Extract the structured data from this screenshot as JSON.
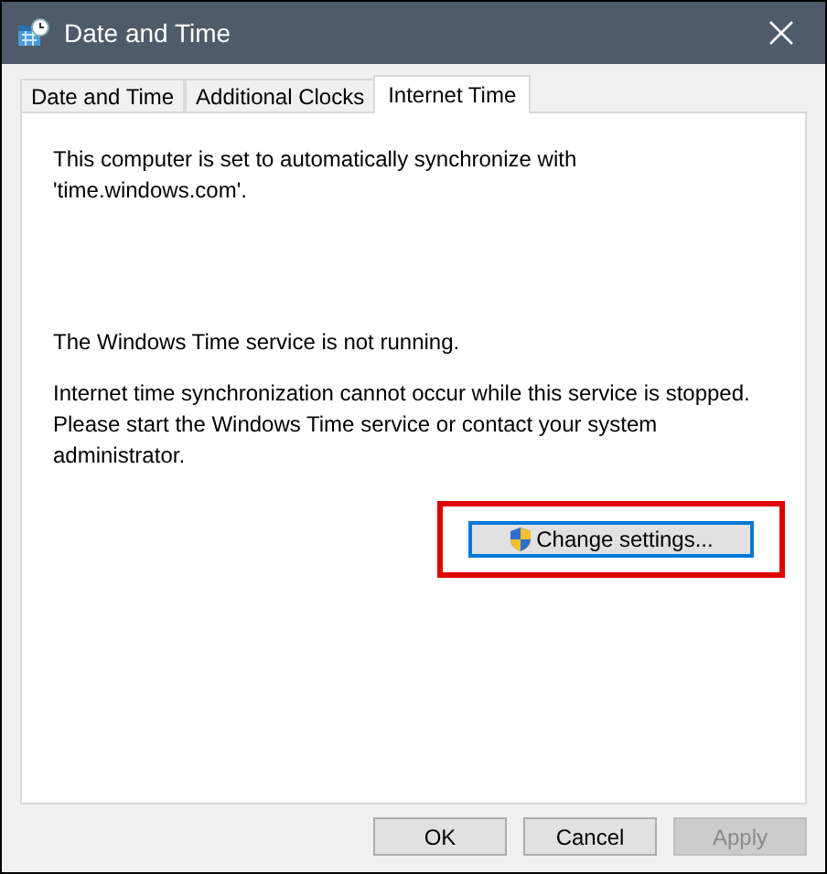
{
  "window": {
    "title": "Date and Time"
  },
  "tabs": [
    {
      "label": "Date and Time",
      "selected": false
    },
    {
      "label": "Additional Clocks",
      "selected": false
    },
    {
      "label": "Internet Time",
      "selected": true
    }
  ],
  "sync_message": "This computer is set to automatically synchronize with 'time.windows.com'.",
  "service_status": "The Windows Time service is not running.",
  "service_help": "Internet time synchronization cannot occur while this service is stopped. Please start the Windows Time service or contact your system administrator.",
  "change_settings": {
    "label": "Change settings...",
    "highlighted": true
  },
  "buttons": [
    {
      "label": "OK",
      "disabled": false
    },
    {
      "label": "Cancel",
      "disabled": false
    },
    {
      "label": "Apply",
      "disabled": true
    }
  ]
}
